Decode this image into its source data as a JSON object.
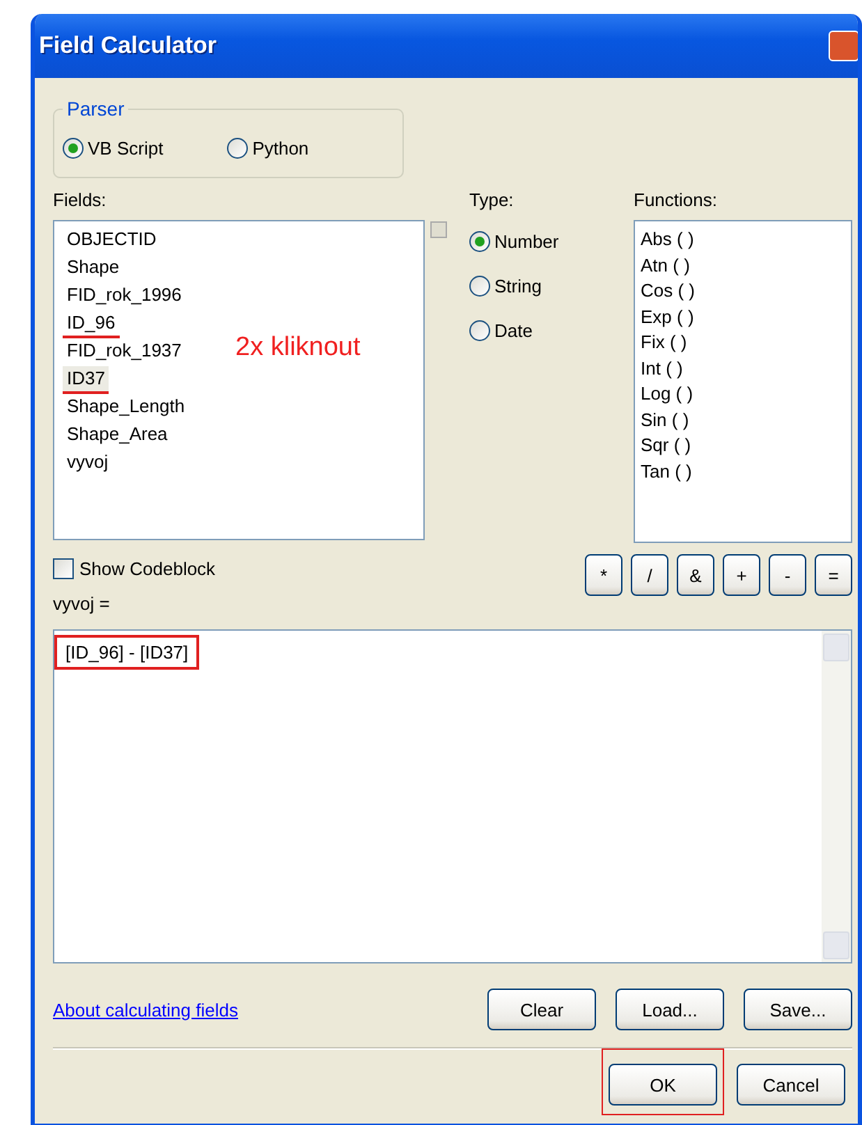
{
  "window": {
    "title": "Field Calculator"
  },
  "parser": {
    "label": "Parser",
    "options": [
      {
        "label": "VB Script",
        "selected": true
      },
      {
        "label": "Python",
        "selected": false
      }
    ]
  },
  "fields": {
    "label": "Fields:",
    "items": [
      {
        "name": "OBJECTID",
        "underlined": false,
        "selected": false
      },
      {
        "name": "Shape",
        "underlined": false,
        "selected": false
      },
      {
        "name": "FID_rok_1996",
        "underlined": false,
        "selected": false
      },
      {
        "name": "ID_96",
        "underlined": true,
        "selected": false
      },
      {
        "name": "FID_rok_1937",
        "underlined": false,
        "selected": false
      },
      {
        "name": "ID37",
        "underlined": true,
        "selected": true
      },
      {
        "name": "Shape_Length",
        "underlined": false,
        "selected": false
      },
      {
        "name": "Shape_Area",
        "underlined": false,
        "selected": false
      },
      {
        "name": "vyvoj",
        "underlined": false,
        "selected": false
      }
    ],
    "annotation": "2x kliknout"
  },
  "type": {
    "label": "Type:",
    "options": [
      {
        "label": "Number",
        "selected": true
      },
      {
        "label": "String",
        "selected": false
      },
      {
        "label": "Date",
        "selected": false
      }
    ]
  },
  "functions": {
    "label": "Functions:",
    "items": [
      "Abs ( )",
      "Atn ( )",
      "Cos ( )",
      "Exp ( )",
      "Fix ( )",
      "Int ( )",
      "Log ( )",
      "Sin ( )",
      "Sqr ( )",
      "Tan ( )"
    ]
  },
  "show_codeblock": {
    "label": "Show Codeblock",
    "checked": false
  },
  "operators": [
    "*",
    "/",
    "&",
    "+",
    "-",
    "="
  ],
  "expression": {
    "label": "vyvoj =",
    "value": "[ID_96] - [ID37]",
    "boxed": true
  },
  "link": "About calculating fields",
  "file_buttons": [
    "Clear",
    "Load...",
    "Save..."
  ],
  "dialog_buttons": [
    {
      "label": "OK",
      "boxed": true
    },
    {
      "label": "Cancel",
      "boxed": false
    }
  ]
}
